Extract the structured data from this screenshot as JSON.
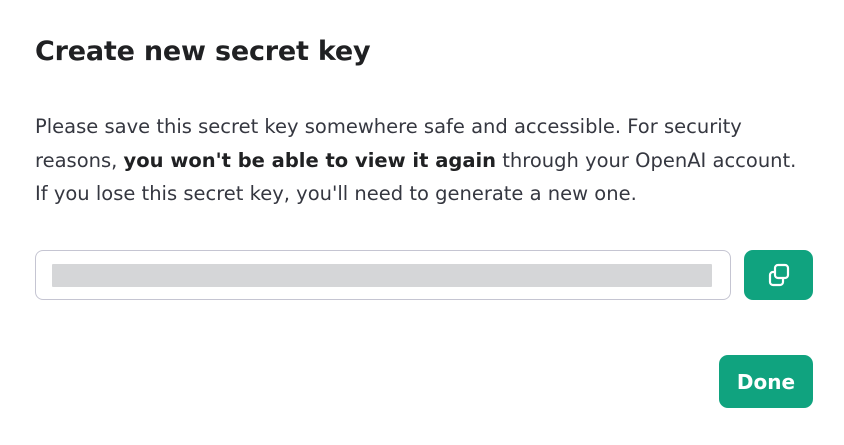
{
  "dialog": {
    "title": "Create new secret key",
    "message": {
      "part1": "Please save this secret key somewhere safe and accessible. For security reasons, ",
      "emphasis": "you won't be able to view it again",
      "part2": " through your OpenAI account. If you lose this secret key, you'll need to generate a new one."
    },
    "secret_key_value": "",
    "copy_icon": "copy-icon",
    "done_label": "Done"
  },
  "colors": {
    "accent": "#10a37f",
    "redaction": "#d5d6d8",
    "border": "#c5c5d2",
    "title": "#202123"
  }
}
